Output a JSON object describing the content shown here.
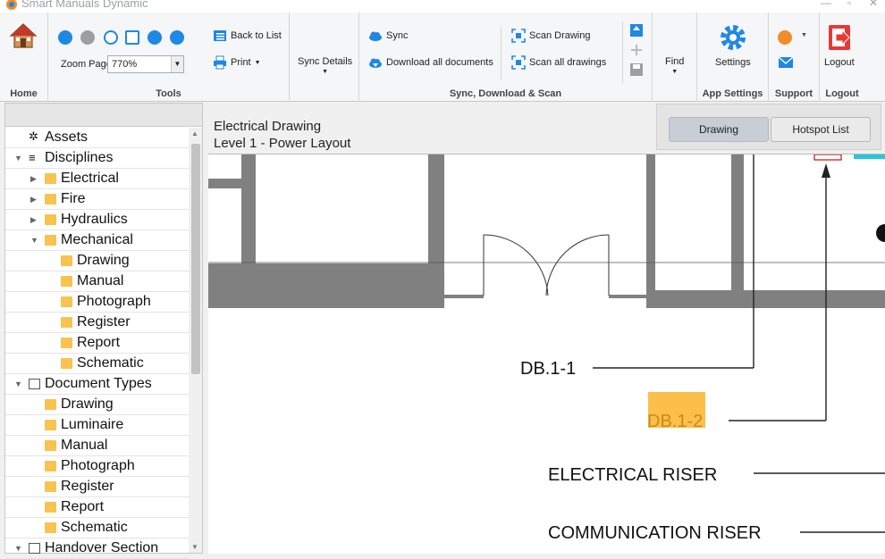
{
  "app": {
    "title": "Smart Manuals Dynamic"
  },
  "ribbon": {
    "home": {
      "group_label": "Home"
    },
    "tools": {
      "group_label": "Tools",
      "zoom_label": "Zoom Page",
      "zoom_value": "770%"
    },
    "list": {
      "back_label": "Back to List",
      "print_label": "Print"
    },
    "sync_details": {
      "label": "Sync Details"
    },
    "sync": {
      "group_label": "Sync, Download & Scan",
      "sync_label": "Sync",
      "download_label": "Download all documents",
      "scan_drawing_label": "Scan Drawing",
      "scan_all_label": "Scan all drawings"
    },
    "find": {
      "label": "Find"
    },
    "app_settings": {
      "group_label": "App Settings",
      "settings_label": "Settings"
    },
    "support": {
      "group_label": "Support"
    },
    "logout": {
      "group_label": "Logout",
      "logout_label": "Logout"
    }
  },
  "tree": {
    "items": [
      {
        "label": "Assets",
        "level": 1,
        "arrow": "",
        "icon": "gear-icon"
      },
      {
        "label": "Disciplines",
        "level": 1,
        "arrow": "expanded",
        "icon": "list-icon"
      },
      {
        "label": "Electrical",
        "level": 2,
        "arrow": "collapsed",
        "icon": "folder-icon"
      },
      {
        "label": "Fire",
        "level": 2,
        "arrow": "collapsed",
        "icon": "folder-icon"
      },
      {
        "label": "Hydraulics",
        "level": 2,
        "arrow": "collapsed",
        "icon": "folder-icon"
      },
      {
        "label": "Mechanical",
        "level": 2,
        "arrow": "expanded",
        "icon": "folder-icon"
      },
      {
        "label": "Drawing",
        "level": 3,
        "arrow": "",
        "icon": "folder-icon"
      },
      {
        "label": "Manual",
        "level": 3,
        "arrow": "",
        "icon": "folder-icon"
      },
      {
        "label": "Photograph",
        "level": 3,
        "arrow": "",
        "icon": "folder-icon"
      },
      {
        "label": "Register",
        "level": 3,
        "arrow": "",
        "icon": "folder-icon"
      },
      {
        "label": "Report",
        "level": 3,
        "arrow": "",
        "icon": "folder-icon"
      },
      {
        "label": "Schematic",
        "level": 3,
        "arrow": "",
        "icon": "folder-icon"
      },
      {
        "label": "Document Types",
        "level": 1,
        "arrow": "expanded",
        "icon": "document-icon"
      },
      {
        "label": "Drawing",
        "level": 2,
        "arrow": "",
        "icon": "folder-icon"
      },
      {
        "label": "Luminaire",
        "level": 2,
        "arrow": "",
        "icon": "folder-icon"
      },
      {
        "label": "Manual",
        "level": 2,
        "arrow": "",
        "icon": "folder-icon"
      },
      {
        "label": "Photograph",
        "level": 2,
        "arrow": "",
        "icon": "folder-icon"
      },
      {
        "label": "Register",
        "level": 2,
        "arrow": "",
        "icon": "folder-icon"
      },
      {
        "label": "Report",
        "level": 2,
        "arrow": "",
        "icon": "folder-icon"
      },
      {
        "label": "Schematic",
        "level": 2,
        "arrow": "",
        "icon": "folder-icon"
      },
      {
        "label": "Handover Section",
        "level": 1,
        "arrow": "expanded",
        "icon": "document-icon"
      }
    ]
  },
  "document": {
    "title_line1": "Electrical Drawing",
    "title_line2": "Level 1 - Power Layout"
  },
  "tabs": {
    "drawing": "Drawing",
    "hotspot_list": "Hotspot List",
    "active": "drawing"
  },
  "drawing": {
    "labels": {
      "db11": "DB.1-1",
      "db12": "DB.1-2",
      "electrical_riser": "ELECTRICAL RISER",
      "communication_riser": "COMMUNICATION  RISER"
    },
    "highlight_color": "#fbbf4a"
  },
  "colors": {
    "accent_blue": "#1e88e5",
    "wall_gray": "#808080",
    "logout_red": "#e53935"
  }
}
